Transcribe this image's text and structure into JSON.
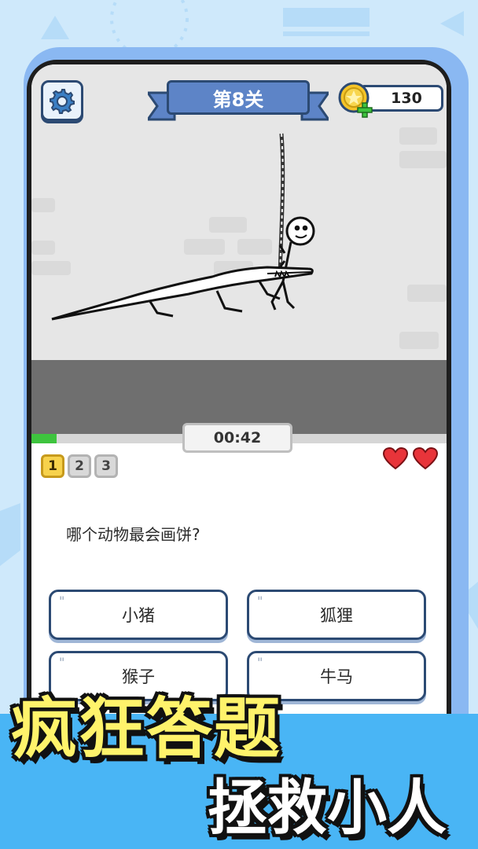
{
  "header": {
    "level_label": "第8关",
    "coins": "130"
  },
  "timer": "00:42",
  "progress": 0.06,
  "stages": [
    "1",
    "2",
    "3"
  ],
  "active_stage": "1",
  "lives": 2,
  "question": "哪个动物最会画饼?",
  "answers": [
    "小猪",
    "狐狸",
    "猴子",
    "牛马"
  ],
  "promo": {
    "headline": "疯狂答题",
    "subline": "拯救小人"
  },
  "colors": {
    "accent": "#5d84c7",
    "border": "#2c4a73",
    "progress": "#3ec43e",
    "promo_bar": "#49b5f5",
    "headline": "#fff36b"
  },
  "icons": {
    "settings": "gear-icon",
    "coin": "coin-icon",
    "add": "plus-icon",
    "life": "heart-icon"
  }
}
